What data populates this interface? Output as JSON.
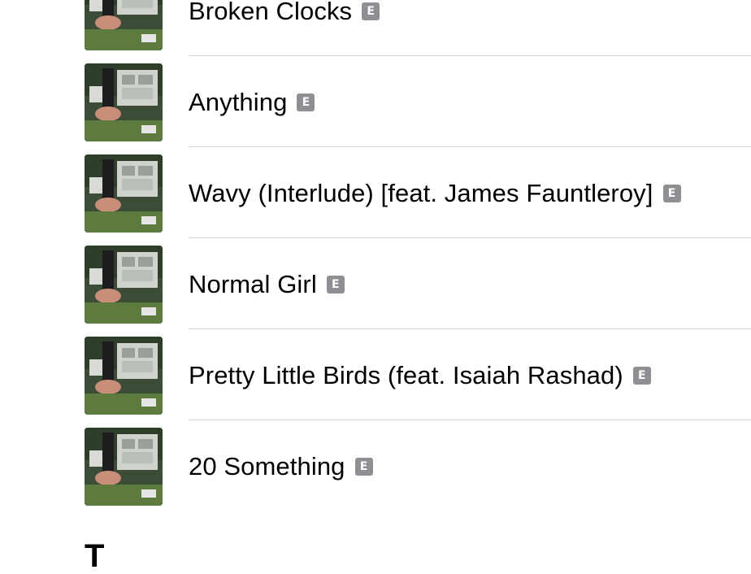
{
  "tracks": [
    {
      "title": "Broken Clocks",
      "explicit_label": "E"
    },
    {
      "title": "Anything",
      "explicit_label": "E"
    },
    {
      "title": "Wavy (Interlude) [feat. James Fauntleroy]",
      "explicit_label": "E"
    },
    {
      "title": "Normal Girl",
      "explicit_label": "E"
    },
    {
      "title": "Pretty Little Birds (feat. Isaiah Rashad)",
      "explicit_label": "E"
    },
    {
      "title": "20 Something",
      "explicit_label": "E"
    }
  ],
  "next_section": {
    "letter": "T"
  },
  "colors": {
    "explicit_badge": "#8e8e93",
    "separator": "#d5d5d8",
    "text": "#000000"
  }
}
